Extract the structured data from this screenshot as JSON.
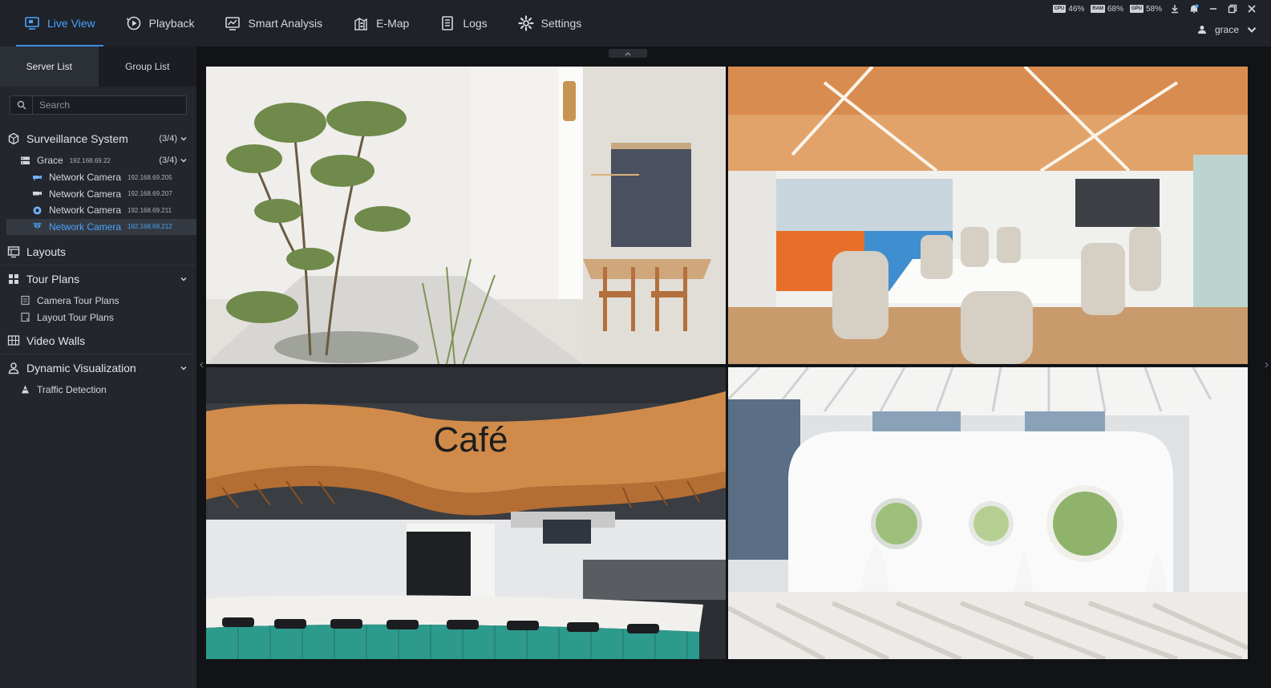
{
  "nav": {
    "items": [
      {
        "label": "Live View",
        "icon": "live-view-icon",
        "active": true
      },
      {
        "label": "Playback",
        "icon": "playback-icon"
      },
      {
        "label": "Smart Analysis",
        "icon": "smart-analysis-icon"
      },
      {
        "label": "E-Map",
        "icon": "emap-icon"
      },
      {
        "label": "Logs",
        "icon": "logs-icon"
      },
      {
        "label": "Settings",
        "icon": "settings-icon"
      }
    ]
  },
  "system": {
    "cpu_label": "CPU",
    "cpu": "46%",
    "ram_label": "RAM",
    "ram": "68%",
    "gpu_label": "GPU",
    "gpu": "58%"
  },
  "user": {
    "name": "grace"
  },
  "sidebar": {
    "tabs": [
      "Server List",
      "Group List"
    ],
    "search_placeholder": "Search",
    "surveillance": {
      "label": "Surveillance System",
      "count": "(3/4)"
    },
    "server": {
      "label": "Grace",
      "ip": "192.168.69.22",
      "count": "(3/4)"
    },
    "cameras": [
      {
        "label": "Network Camera",
        "ip": "192.168.69.205",
        "icon": "bullet-camera-icon"
      },
      {
        "label": "Network Camera",
        "ip": "192.168.69.207",
        "icon": "box-camera-icon"
      },
      {
        "label": "Network Camera",
        "ip": "192.168.69.211",
        "icon": "fisheye-camera-icon"
      },
      {
        "label": "Network Camera",
        "ip": "192.168.69.212",
        "icon": "dome-camera-icon",
        "selected": true
      }
    ],
    "layouts": "Layouts",
    "tour_plans": "Tour Plans",
    "camera_tour_plans": "Camera Tour Plans",
    "layout_tour_plans": "Layout Tour Plans",
    "video_walls": "Video Walls",
    "dynamic_visualization": "Dynamic Visualization",
    "traffic_detection": "Traffic Detection"
  },
  "feeds": {
    "cafe_sign": "Café"
  },
  "colors": {
    "accent": "#4aa3ff",
    "background": "#1e2127",
    "sidebar": "#23262c"
  }
}
